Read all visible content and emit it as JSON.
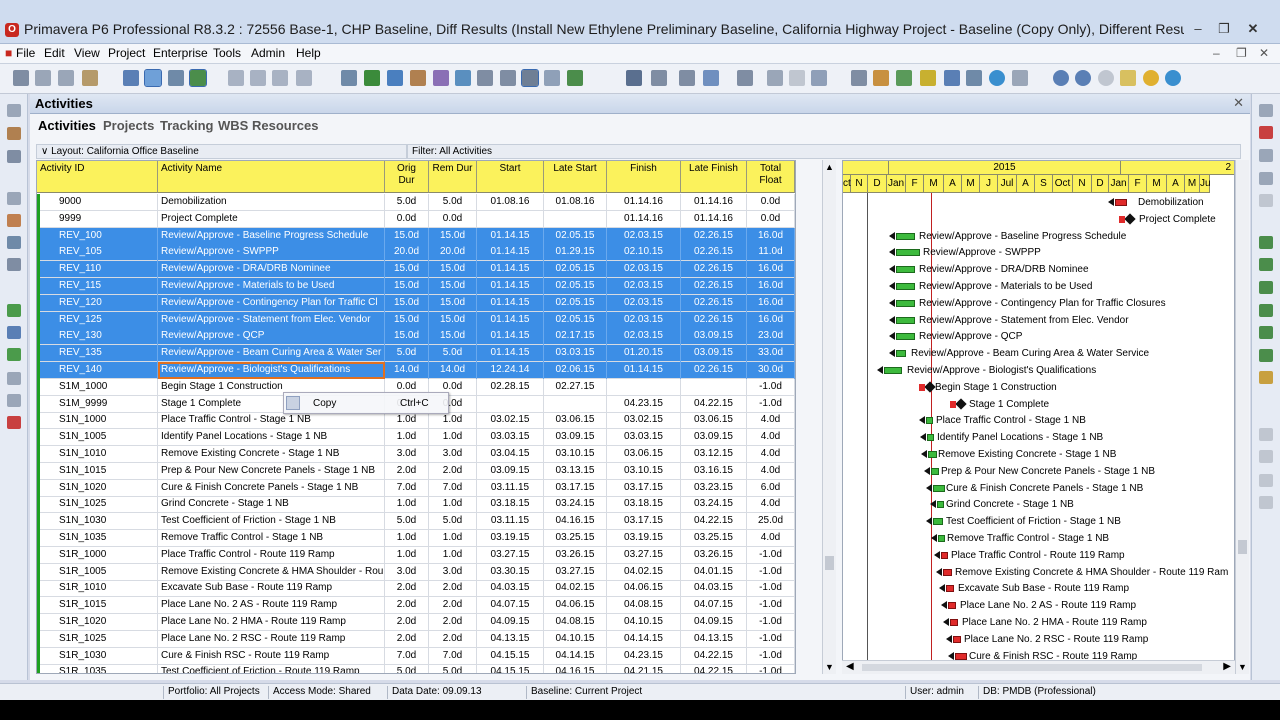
{
  "window": {
    "title": "Primavera P6 Professional R8.3.2 : 72556 Base-1, CHP Baseline, Diff Results (Install New Ethylene Preliminary Baseline, California Highway Project - Baseline (Copy Only), Different Results for ..."
  },
  "menu": [
    "File",
    "Edit",
    "View",
    "Project",
    "Enterprise",
    "Tools",
    "Admin",
    "Help"
  ],
  "panel": {
    "title": "Activities",
    "tabs": [
      "Activities",
      "Projects",
      "Tracking",
      "WBS",
      "Resources"
    ]
  },
  "layout_label": "Layout: California Office Baseline",
  "filter_label": "Filter: All Activities",
  "columns": [
    "Activity ID",
    "Activity Name",
    "Orig Dur",
    "Rem Dur",
    "Start",
    "Late Start",
    "Finish",
    "Late Finish",
    "Total Float"
  ],
  "rows": [
    {
      "id": "9000",
      "name": "Demobilization",
      "od": "5.0d",
      "rd": "5.0d",
      "start": "01.08.16",
      "ls": "01.08.16",
      "finish": "01.14.16",
      "lf": "01.14.16",
      "tf": "0.0d",
      "sel": false
    },
    {
      "id": "9999",
      "name": "Project Complete",
      "od": "0.0d",
      "rd": "0.0d",
      "start": "",
      "ls": "",
      "finish": "01.14.16",
      "lf": "01.14.16",
      "tf": "0.0d",
      "sel": false
    },
    {
      "id": "REV_100",
      "name": "Review/Approve - Baseline Progress Schedule",
      "od": "15.0d",
      "rd": "15.0d",
      "start": "01.14.15",
      "ls": "02.05.15",
      "finish": "02.03.15",
      "lf": "02.26.15",
      "tf": "16.0d",
      "sel": true
    },
    {
      "id": "REV_105",
      "name": "Review/Approve - SWPPP",
      "od": "20.0d",
      "rd": "20.0d",
      "start": "01.14.15",
      "ls": "01.29.15",
      "finish": "02.10.15",
      "lf": "02.26.15",
      "tf": "11.0d",
      "sel": true
    },
    {
      "id": "REV_110",
      "name": "Review/Approve - DRA/DRB Nominee",
      "od": "15.0d",
      "rd": "15.0d",
      "start": "01.14.15",
      "ls": "02.05.15",
      "finish": "02.03.15",
      "lf": "02.26.15",
      "tf": "16.0d",
      "sel": true
    },
    {
      "id": "REV_115",
      "name": "Review/Approve - Materials to be Used",
      "od": "15.0d",
      "rd": "15.0d",
      "start": "01.14.15",
      "ls": "02.05.15",
      "finish": "02.03.15",
      "lf": "02.26.15",
      "tf": "16.0d",
      "sel": true
    },
    {
      "id": "REV_120",
      "name": "Review/Approve - Contingency Plan for Traffic Cl",
      "od": "15.0d",
      "rd": "15.0d",
      "start": "01.14.15",
      "ls": "02.05.15",
      "finish": "02.03.15",
      "lf": "02.26.15",
      "tf": "16.0d",
      "sel": true
    },
    {
      "id": "REV_125",
      "name": "Review/Approve - Statement from Elec. Vendor",
      "od": "15.0d",
      "rd": "15.0d",
      "start": "01.14.15",
      "ls": "02.05.15",
      "finish": "02.03.15",
      "lf": "02.26.15",
      "tf": "16.0d",
      "sel": true
    },
    {
      "id": "REV_130",
      "name": "Review/Approve - QCP",
      "od": "15.0d",
      "rd": "15.0d",
      "start": "01.14.15",
      "ls": "02.17.15",
      "finish": "02.03.15",
      "lf": "03.09.15",
      "tf": "23.0d",
      "sel": true
    },
    {
      "id": "REV_135",
      "name": "Review/Approve - Beam Curing Area & Water Ser",
      "od": "5.0d",
      "rd": "5.0d",
      "start": "01.14.15",
      "ls": "03.03.15",
      "finish": "01.20.15",
      "lf": "03.09.15",
      "tf": "33.0d",
      "sel": true
    },
    {
      "id": "REV_140",
      "name": "Review/Approve - Biologist's Qualifications",
      "od": "14.0d",
      "rd": "14.0d",
      "start": "12.24.14",
      "ls": "02.06.15",
      "finish": "01.14.15",
      "lf": "02.26.15",
      "tf": "30.0d",
      "sel": true
    },
    {
      "id": "S1M_1000",
      "name": "Begin Stage 1 Construction",
      "od": "0.0d",
      "rd": "0.0d",
      "start": "02.28.15",
      "ls": "02.27.15",
      "finish": "",
      "lf": "",
      "tf": "-1.0d",
      "sel": false
    },
    {
      "id": "S1M_9999",
      "name": "Stage 1 Complete",
      "od": "0.0d",
      "rd": "0.0d",
      "start": "",
      "ls": "",
      "finish": "04.23.15",
      "lf": "04.22.15",
      "tf": "-1.0d",
      "sel": false
    },
    {
      "id": "S1N_1000",
      "name": "Place Traffic Control - Stage 1 NB",
      "od": "1.0d",
      "rd": "1.0d",
      "start": "03.02.15",
      "ls": "03.06.15",
      "finish": "03.02.15",
      "lf": "03.06.15",
      "tf": "4.0d",
      "sel": false
    },
    {
      "id": "S1N_1005",
      "name": "Identify Panel Locations - Stage 1 NB",
      "od": "1.0d",
      "rd": "1.0d",
      "start": "03.03.15",
      "ls": "03.09.15",
      "finish": "03.03.15",
      "lf": "03.09.15",
      "tf": "4.0d",
      "sel": false
    },
    {
      "id": "S1N_1010",
      "name": "Remove Existing Concrete - Stage 1 NB",
      "od": "3.0d",
      "rd": "3.0d",
      "start": "03.04.15",
      "ls": "03.10.15",
      "finish": "03.06.15",
      "lf": "03.12.15",
      "tf": "4.0d",
      "sel": false
    },
    {
      "id": "S1N_1015",
      "name": "Prep & Pour New Concrete Panels - Stage 1 NB",
      "od": "2.0d",
      "rd": "2.0d",
      "start": "03.09.15",
      "ls": "03.13.15",
      "finish": "03.10.15",
      "lf": "03.16.15",
      "tf": "4.0d",
      "sel": false
    },
    {
      "id": "S1N_1020",
      "name": "Cure & Finish Concrete Panels - Stage 1 NB",
      "od": "7.0d",
      "rd": "7.0d",
      "start": "03.11.15",
      "ls": "03.17.15",
      "finish": "03.17.15",
      "lf": "03.23.15",
      "tf": "6.0d",
      "sel": false
    },
    {
      "id": "S1N_1025",
      "name": "Grind Concrete - Stage 1 NB",
      "od": "1.0d",
      "rd": "1.0d",
      "start": "03.18.15",
      "ls": "03.24.15",
      "finish": "03.18.15",
      "lf": "03.24.15",
      "tf": "4.0d",
      "sel": false
    },
    {
      "id": "S1N_1030",
      "name": "Test Coefficient of Friction - Stage 1 NB",
      "od": "5.0d",
      "rd": "5.0d",
      "start": "03.11.15",
      "ls": "04.16.15",
      "finish": "03.17.15",
      "lf": "04.22.15",
      "tf": "25.0d",
      "sel": false
    },
    {
      "id": "S1N_1035",
      "name": "Remove Traffic Control - Stage 1 NB",
      "od": "1.0d",
      "rd": "1.0d",
      "start": "03.19.15",
      "ls": "03.25.15",
      "finish": "03.19.15",
      "lf": "03.25.15",
      "tf": "4.0d",
      "sel": false
    },
    {
      "id": "S1R_1000",
      "name": "Place Traffic Control - Route 119 Ramp",
      "od": "1.0d",
      "rd": "1.0d",
      "start": "03.27.15",
      "ls": "03.26.15",
      "finish": "03.27.15",
      "lf": "03.26.15",
      "tf": "-1.0d",
      "sel": false
    },
    {
      "id": "S1R_1005",
      "name": "Remove Existing Concrete & HMA Shoulder - Rou",
      "od": "3.0d",
      "rd": "3.0d",
      "start": "03.30.15",
      "ls": "03.27.15",
      "finish": "04.02.15",
      "lf": "04.01.15",
      "tf": "-1.0d",
      "sel": false
    },
    {
      "id": "S1R_1010",
      "name": "Excavate Sub Base - Route 119 Ramp",
      "od": "2.0d",
      "rd": "2.0d",
      "start": "04.03.15",
      "ls": "04.02.15",
      "finish": "04.06.15",
      "lf": "04.03.15",
      "tf": "-1.0d",
      "sel": false
    },
    {
      "id": "S1R_1015",
      "name": "Place Lane No. 2 AS - Route 119 Ramp",
      "od": "2.0d",
      "rd": "2.0d",
      "start": "04.07.15",
      "ls": "04.06.15",
      "finish": "04.08.15",
      "lf": "04.07.15",
      "tf": "-1.0d",
      "sel": false
    },
    {
      "id": "S1R_1020",
      "name": "Place Lane No. 2 HMA - Route 119 Ramp",
      "od": "2.0d",
      "rd": "2.0d",
      "start": "04.09.15",
      "ls": "04.08.15",
      "finish": "04.10.15",
      "lf": "04.09.15",
      "tf": "-1.0d",
      "sel": false
    },
    {
      "id": "S1R_1025",
      "name": "Place Lane No. 2 RSC - Route 119 Ramp",
      "od": "2.0d",
      "rd": "2.0d",
      "start": "04.13.15",
      "ls": "04.10.15",
      "finish": "04.14.15",
      "lf": "04.13.15",
      "tf": "-1.0d",
      "sel": false
    },
    {
      "id": "S1R_1030",
      "name": "Cure & Finish RSC - Route 119 Ramp",
      "od": "7.0d",
      "rd": "7.0d",
      "start": "04.15.15",
      "ls": "04.14.15",
      "finish": "04.23.15",
      "lf": "04.22.15",
      "tf": "-1.0d",
      "sel": false
    },
    {
      "id": "S1R_1035",
      "name": "Test Coefficient of Friction - Route 119 Ramp",
      "od": "5.0d",
      "rd": "5.0d",
      "start": "04.15.15",
      "ls": "04.16.15",
      "finish": "04.21.15",
      "lf": "04.22.15",
      "tf": "-1.0d",
      "sel": false
    }
  ],
  "context_menu": {
    "item": "Copy",
    "shortcut": "Ctrl+C"
  },
  "gantt": {
    "year": "2015",
    "months": [
      "ct",
      "N",
      "D",
      "Jan",
      "F",
      "M",
      "A",
      "M",
      "J",
      "Jul",
      "A",
      "S",
      "Oct",
      "N",
      "D",
      "Jan",
      "F",
      "M",
      "A",
      "M",
      "Ju"
    ],
    "labels": [
      "Demobilization",
      "Project Complete",
      "Review/Approve - Baseline Progress Schedule",
      "Review/Approve - SWPPP",
      "Review/Approve - DRA/DRB Nominee",
      "Review/Approve - Materials to be Used",
      "Review/Approve - Contingency Plan for Traffic Closures",
      "Review/Approve - Statement from Elec. Vendor",
      "Review/Approve - QCP",
      "Review/Approve - Beam Curing Area & Water Service",
      "Review/Approve - Biologist's Qualifications",
      "Begin Stage 1 Construction",
      "Stage 1 Complete",
      "Place Traffic Control - Stage 1 NB",
      "Identify Panel Locations - Stage 1 NB",
      "Remove Existing Concrete - Stage 1 NB",
      "Prep & Pour New Concrete Panels - Stage 1 NB",
      "Cure & Finish Concrete Panels - Stage 1 NB",
      "Grind Concrete - Stage 1 NB",
      "Test Coefficient of Friction - Stage 1 NB",
      "Remove Traffic Control - Stage 1 NB",
      "Place Traffic Control - Route 119 Ramp",
      "Remove Existing Concrete & HMA Shoulder - Route 119 Ram",
      "Excavate Sub Base - Route 119 Ramp",
      "Place Lane No. 2 AS - Route 119 Ramp",
      "Place Lane No. 2 HMA - Route 119 Ramp",
      "Place Lane No. 2 RSC - Route 119 Ramp",
      "Cure & Finish RSC - Route 119 Ramp"
    ]
  },
  "status": {
    "portfolio": "Portfolio: All Projects",
    "access": "Access Mode: Shared",
    "data_date": "Data Date: 09.09.13",
    "baseline": "Baseline: Current Project",
    "user": "User: admin",
    "db": "DB: PMDB (Professional)"
  },
  "colors": {
    "selection": "#3c8ee6",
    "header": "#fbf25c",
    "bar": "#3dba3d",
    "critical": "#d62020"
  }
}
